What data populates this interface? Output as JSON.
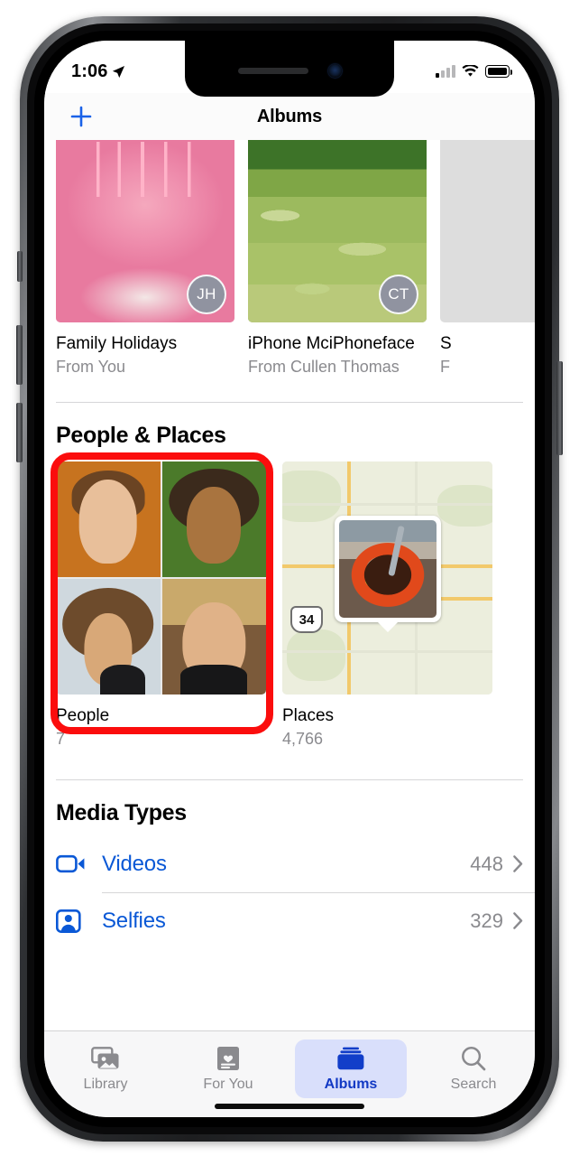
{
  "status_bar": {
    "time": "1:06",
    "location_icon": "location-arrow-icon",
    "signal_icon": "cellular-signal-icon",
    "wifi_icon": "wifi-icon",
    "battery_icon": "battery-full-icon"
  },
  "nav": {
    "add_icon": "plus-icon",
    "title": "Albums"
  },
  "shared_albums": [
    {
      "title": "Family Holidays",
      "subtitle": "From You",
      "avatar_initials": "JH",
      "thumb": "birthday-cake-photo"
    },
    {
      "title": "iPhone MciPhoneface",
      "subtitle": "From Cullen Thomas",
      "avatar_initials": "CT",
      "thumb": "grass-field-photo"
    },
    {
      "title": "S",
      "subtitle": "F",
      "avatar_initials": "",
      "thumb": "partial-photo"
    }
  ],
  "people_places": {
    "header": "People & Places",
    "items": [
      {
        "title": "People",
        "count": "7",
        "thumb": "faces-grid"
      },
      {
        "title": "Places",
        "count": "4,766",
        "thumb": "map-with-photo-pin"
      }
    ],
    "map_highway_label": "34",
    "annotation_color": "#fb0d0d",
    "annotation_target": "People"
  },
  "media_types": {
    "header": "Media Types",
    "rows": [
      {
        "label": "Videos",
        "count": "448",
        "icon": "video-camera-icon",
        "chevron": "chevron-right-icon"
      },
      {
        "label": "Selfies",
        "count": "329",
        "icon": "selfie-person-icon",
        "chevron": "chevron-right-icon"
      }
    ]
  },
  "tab_bar": {
    "tabs": [
      {
        "label": "Library",
        "icon": "photo-stack-icon",
        "active": false
      },
      {
        "label": "For You",
        "icon": "heart-card-icon",
        "active": false
      },
      {
        "label": "Albums",
        "icon": "albums-folder-icon",
        "active": true
      },
      {
        "label": "Search",
        "icon": "magnifier-icon",
        "active": false
      }
    ]
  },
  "colors": {
    "accent_blue": "#0a58d6",
    "tab_active_bg": "#d9dffb",
    "tab_active_text": "#1239c4",
    "secondary_text": "#8a8a8e",
    "annotation_red": "#fb0d0d"
  }
}
